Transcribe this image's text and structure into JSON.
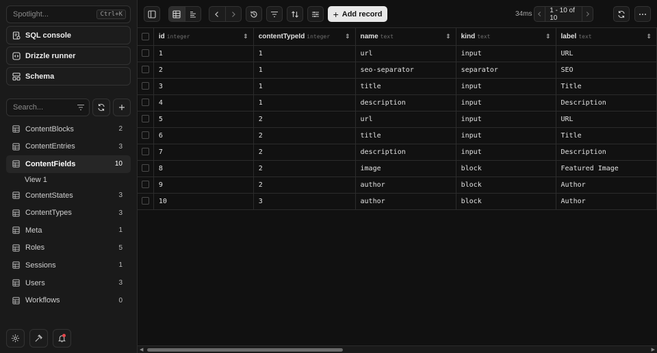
{
  "spotlight": {
    "placeholder": "Spotlight...",
    "shortcut": "Ctrl+K"
  },
  "sidebar_buttons": [
    {
      "label": "SQL console",
      "icon": "sql-console-icon"
    },
    {
      "label": "Drizzle runner",
      "icon": "code-icon"
    },
    {
      "label": "Schema",
      "icon": "schema-icon"
    }
  ],
  "search": {
    "placeholder": "Search..."
  },
  "tables": [
    {
      "name": "ContentBlocks",
      "count": "2"
    },
    {
      "name": "ContentEntries",
      "count": "3"
    },
    {
      "name": "ContentFields",
      "count": "10",
      "active": true
    },
    {
      "name": "View 1",
      "sub": true
    },
    {
      "name": "ContentStates",
      "count": "3"
    },
    {
      "name": "ContentTypes",
      "count": "3"
    },
    {
      "name": "Meta",
      "count": "1"
    },
    {
      "name": "Roles",
      "count": "5"
    },
    {
      "name": "Sessions",
      "count": "1"
    },
    {
      "name": "Users",
      "count": "3"
    },
    {
      "name": "Workflows",
      "count": "0"
    }
  ],
  "toolbar": {
    "add_record": "Add record",
    "latency": "34ms",
    "pager": "1 - 10  of  10"
  },
  "columns": [
    {
      "name": "id",
      "type": "integer"
    },
    {
      "name": "contentTypeId",
      "type": "integer"
    },
    {
      "name": "name",
      "type": "text"
    },
    {
      "name": "kind",
      "type": "text"
    },
    {
      "name": "label",
      "type": "text"
    }
  ],
  "rows": [
    [
      "1",
      "1",
      "url",
      "input",
      "URL"
    ],
    [
      "2",
      "1",
      "seo-separator",
      "separator",
      "SEO"
    ],
    [
      "3",
      "1",
      "title",
      "input",
      "Title"
    ],
    [
      "4",
      "1",
      "description",
      "input",
      "Description"
    ],
    [
      "5",
      "2",
      "url",
      "input",
      "URL"
    ],
    [
      "6",
      "2",
      "title",
      "input",
      "Title"
    ],
    [
      "7",
      "2",
      "description",
      "input",
      "Description"
    ],
    [
      "8",
      "2",
      "image",
      "block",
      "Featured Image"
    ],
    [
      "9",
      "2",
      "author",
      "block",
      "Author"
    ],
    [
      "10",
      "3",
      "author",
      "block",
      "Author"
    ]
  ],
  "colors": {
    "background": "#111111",
    "sidebar": "#1a1a1a",
    "border": "#2c2c2c",
    "notification": "#e5484d"
  }
}
